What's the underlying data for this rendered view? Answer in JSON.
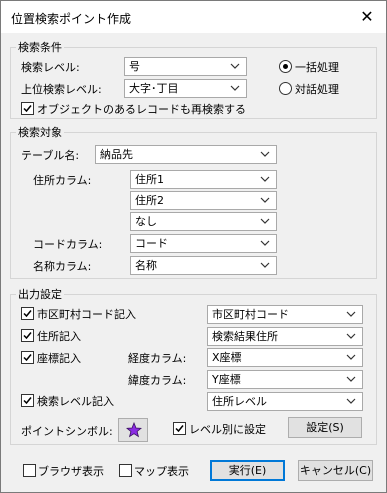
{
  "window": {
    "title": "位置検索ポイント作成",
    "close_glyph": "✕"
  },
  "search_conditions": {
    "legend": "検索条件",
    "search_level_label": "検索レベル:",
    "search_level_value": "号",
    "upper_level_label": "上位検索レベル:",
    "upper_level_value": "大字･丁目",
    "radio_bulk": "一括処理",
    "radio_interactive": "対話処理",
    "research_checkbox": "オブジェクトのあるレコードも再検索する"
  },
  "search_target": {
    "legend": "検索対象",
    "table_label": "テーブル名:",
    "table_value": "納品先",
    "address_col_label": "住所カラム:",
    "address_cols": [
      "住所1",
      "住所2",
      "なし"
    ],
    "code_col_label": "コードカラム:",
    "code_col_value": "コード",
    "name_col_label": "名称カラム:",
    "name_col_value": "名称"
  },
  "output": {
    "legend": "出力設定",
    "city_code_check": "市区町村コード記入",
    "city_code_value": "市区町村コード",
    "address_check": "住所記入",
    "address_value": "検索結果住所",
    "coord_check": "座標記入",
    "lon_label": "経度カラム:",
    "lon_value": "X座標",
    "lat_label": "緯度カラム:",
    "lat_value": "Y座標",
    "level_check": "検索レベル記入",
    "level_value": "住所レベル",
    "symbol_label": "ポイントシンボル:",
    "per_level_check": "レベル別に設定",
    "settings_button": "設定(S)"
  },
  "footer": {
    "browser_check": "ブラウザ表示",
    "map_check": "マップ表示",
    "run_button": "実行(E)",
    "cancel_button": "キャンセル(C)"
  },
  "colors": {
    "accent": "#0078d7",
    "symbol_star": "#8a2be2"
  }
}
